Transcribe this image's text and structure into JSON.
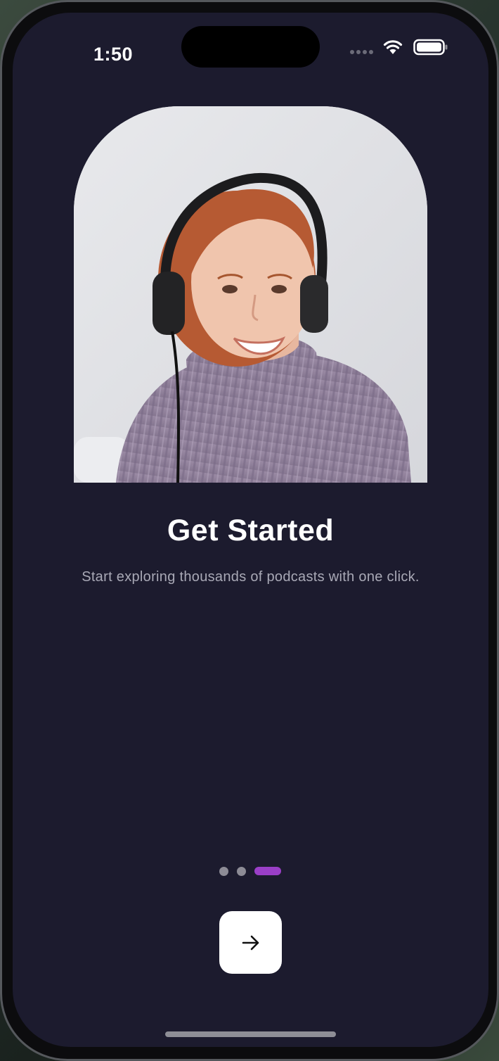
{
  "status_bar": {
    "time": "1:50",
    "wifi_icon": "wifi-icon",
    "battery_icon": "battery-icon"
  },
  "onboarding": {
    "hero_image": "woman-with-headphones-photo",
    "title": "Get Started",
    "subtitle": "Start exploring thousands of podcasts with one click.",
    "page_count": 3,
    "active_page": 3,
    "next_button_icon": "arrow-right-icon"
  },
  "colors": {
    "background": "#1c1b2e",
    "accent": "#9a3fc7",
    "inactive_dot": "#8d8c96",
    "title": "#ffffff",
    "subtitle": "#a9a9b6",
    "button": "#ffffff"
  }
}
